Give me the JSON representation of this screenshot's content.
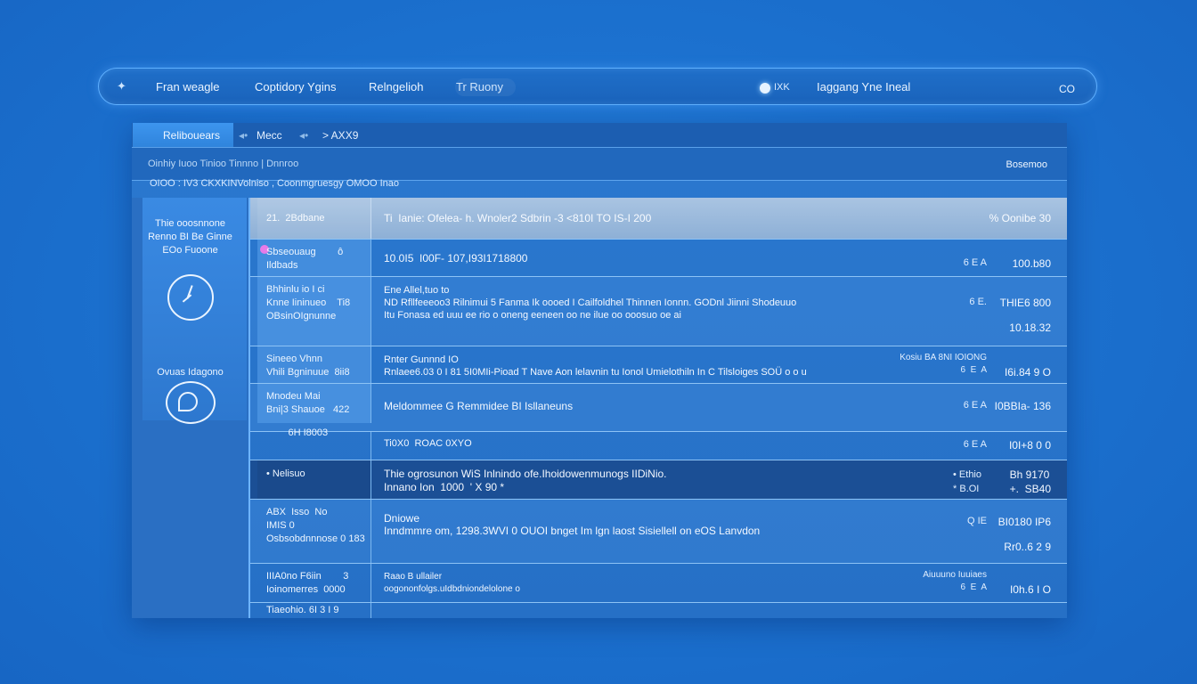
{
  "topnav": {
    "logo": "✦",
    "items": [
      "Fran weagle",
      "Coptidory Ygins",
      "Relngelioh",
      "Tr Ruony"
    ],
    "sun_label": "IXK",
    "region": "Iaggang Yne Ineal",
    "right": "CO"
  },
  "tabs": {
    "active": "Relibouears",
    "t1": "Mecc",
    "t2": "> AXX9"
  },
  "subbar": {
    "cols": "Oinhiy  Iuoo  Tinioo  Tinnno |  Dnnroo",
    "ext": "Bosemoo"
  },
  "infobar": "OIOO : IV3 CKXKINVolniso , Coonmgruesgy OMOO Inao",
  "side": {
    "desc_1": "Thie ooosnnone",
    "desc_2": "Renno BI Be Ginne",
    "desc_3": "EOo Fuoone",
    "cap2": "Ovuas Idagono"
  },
  "rows": [
    {
      "cat": "21.  2Bdbane",
      "body": "Ti  Ianie: Ofelea- h. Wnoler2 Sdbrin -3 <810I TO IS-I 200",
      "meta": "",
      "val": "%  Oonibe 30"
    },
    {
      "cat": "Sbseouaug        ô\nIldbads",
      "body": "10.0I5  I00F- 107,I93I1718800",
      "meta": "6  E  A",
      "val": "100.b80"
    },
    {
      "cat": "Bhhinlu io I ci\nKnne Iininueo    Ti8\nOBsinOIgnunne",
      "body": "Ene Allel,tuo to\nND Rfllfeeeoo3 Rilnimui 5 Fanma Ik oooed I Cailfoldhel Thinnen Ionnn. GODnl Jiinni Shodeuuo\nItu Fonasa ed uuu ee rio o oneng eeneen oo ne ilue oo ooosuo oe ai",
      "meta": "6  E.",
      "val": "THIE6 800",
      "val2": "10.18.32"
    },
    {
      "cat": "Sineeo Vhnn\nVhili Bgninuue  8ii8",
      "body": "Rnter Gunnnd IO\nRnlaee6.03 0 I 81 5I0MIi-Pioad T Nave Aon lelavnin tu Ionol Umielothiln In C Tilsloiges SOÜ o o u",
      "meta": "Kosiu BA 8NI IOIONG\n6  E  A",
      "val": "I6i.84 9 O"
    },
    {
      "cat": "Mnodeu Mai\nBni|3 Shauoe   422",
      "body": "Meldommee G Remmidee BI Isllaneuns",
      "meta": "6  E  A",
      "val": "I0BBIa- 136"
    },
    {
      "cat": "        6H I8003",
      "body": "Ti0X0  ROAC 0XYO",
      "meta": "6  E  A",
      "val": "I0I+8 0 0"
    },
    {
      "cat": "• Nelisuo",
      "body": "Thie ogrosunon WiS Inlnindo ofe.Ihoidowenmunogs IIDiNio.\nInnano Ion  1000  ' X 90 *",
      "meta": "• Ethio\n* B.OI",
      "val": "Bh 9170\n+.  SB40"
    },
    {
      "cat": "ABX  Isso  No\nIMIS 0\nOsbsobdnnnose 0 183",
      "body": "Dniowe\nInndmmre om, 1298.3WVI 0 OUOI bnget Im lgn laost Sisiellell on eOS Lanvdon",
      "meta": "Q IE",
      "val": "BI0180 IP6",
      "val2": "Rr0..6  2 9"
    },
    {
      "cat": "IIIA0no F6iin        3\nIoinomerres  0000",
      "body": "Raao B ullailer\noogononfolgs.uIdbdniondelolone o",
      "meta": "Aiuuuno Iuuiaes\n6  E  A",
      "val": "I0h.6 I O"
    },
    {
      "cat": "Tiaeohio. 6I 3 I 9",
      "body": "",
      "meta": "",
      "val": ""
    }
  ]
}
